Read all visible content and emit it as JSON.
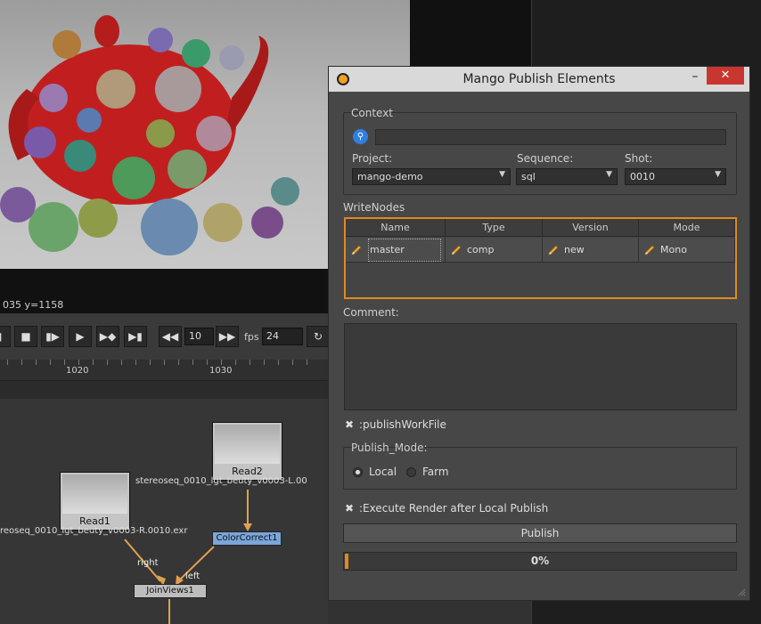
{
  "viewer": {
    "coord_readout": "035 y=1158"
  },
  "playback": {
    "frame_increment": "10",
    "fps_label": "fps",
    "fps_value": "24"
  },
  "timeline": {
    "ticks": [
      "1020",
      "1030"
    ]
  },
  "nodegraph": {
    "read1_label": "Read1",
    "read1_file": "reoseq_0010_lgt_beuty_v0003-R.0010.exr",
    "read2_label": "Read2",
    "read2_file": "stereoseq_0010_lgt_beuty_v0003-L.00",
    "colorcorrect_label": "ColorCorrect1",
    "joinviews_label": "JoinViews1",
    "edge_right": "right",
    "edge_left": "left"
  },
  "dialog": {
    "title": "Mango Publish Elements",
    "min_glyph": "–",
    "close_glyph": "✕",
    "context": {
      "label": "Context",
      "search_value": "",
      "project_label": "Project:",
      "project_value": "mango-demo",
      "sequence_label": "Sequence:",
      "sequence_value": "sql",
      "shot_label": "Shot:",
      "shot_value": "0010"
    },
    "writenodes": {
      "label": "WriteNodes",
      "columns": [
        "Name",
        "Type",
        "Version",
        "Mode"
      ],
      "row": {
        "name": "master",
        "type": "comp",
        "version": "new",
        "mode": "Mono"
      }
    },
    "comment": {
      "label": "Comment:",
      "value": ""
    },
    "publish_workfile": {
      "label": ":publishWorkFile",
      "checked": true
    },
    "publish_mode": {
      "label": "Publish_Mode:",
      "local_label": "Local",
      "farm_label": "Farm",
      "selected": "Local"
    },
    "execute_render": {
      "label": ":Execute Render after Local Publish",
      "checked": true
    },
    "publish_button": "Publish",
    "progress": {
      "text": "0%",
      "value": 0
    },
    "check_glyph": "✖",
    "dropdown_glyph": "▼",
    "search_glyph": "⚲"
  }
}
